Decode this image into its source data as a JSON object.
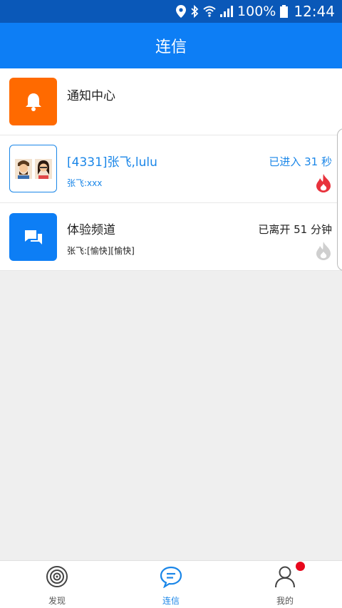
{
  "status_bar": {
    "battery_percent": "100%",
    "time": "12:44",
    "icons": [
      "location-icon",
      "bluetooth-icon",
      "wifi-icon",
      "signal-icon",
      "battery-icon"
    ]
  },
  "header": {
    "title": "连信"
  },
  "conversations": [
    {
      "title": "通知中心",
      "icon": "bell-icon",
      "icon_bg": "#ff6a00"
    },
    {
      "title": "[4331]张飞,lulu",
      "subtitle": "张飞:xxx",
      "status": "已进入 31 秒",
      "accent": "#1a86e8",
      "avatar": "group-avatar",
      "flame_color": "#e8323c"
    },
    {
      "title": "体验频道",
      "subtitle": "张飞:[愉快][愉快]",
      "status": "已离开 51 分钟",
      "icon": "chat-icon",
      "icon_bg": "#0d7ef5",
      "flame_color": "#cfcfcf"
    }
  ],
  "bottom_nav": [
    {
      "label": "发现",
      "icon": "target-icon",
      "active": false
    },
    {
      "label": "连信",
      "icon": "chat-bubble-icon",
      "active": true
    },
    {
      "label": "我的",
      "icon": "person-icon",
      "active": false,
      "badge": true
    }
  ],
  "colors": {
    "status_bar": "#0a58b8",
    "app_bar": "#0d7ef5",
    "accent": "#1a86e8",
    "badge": "#e8071c"
  }
}
